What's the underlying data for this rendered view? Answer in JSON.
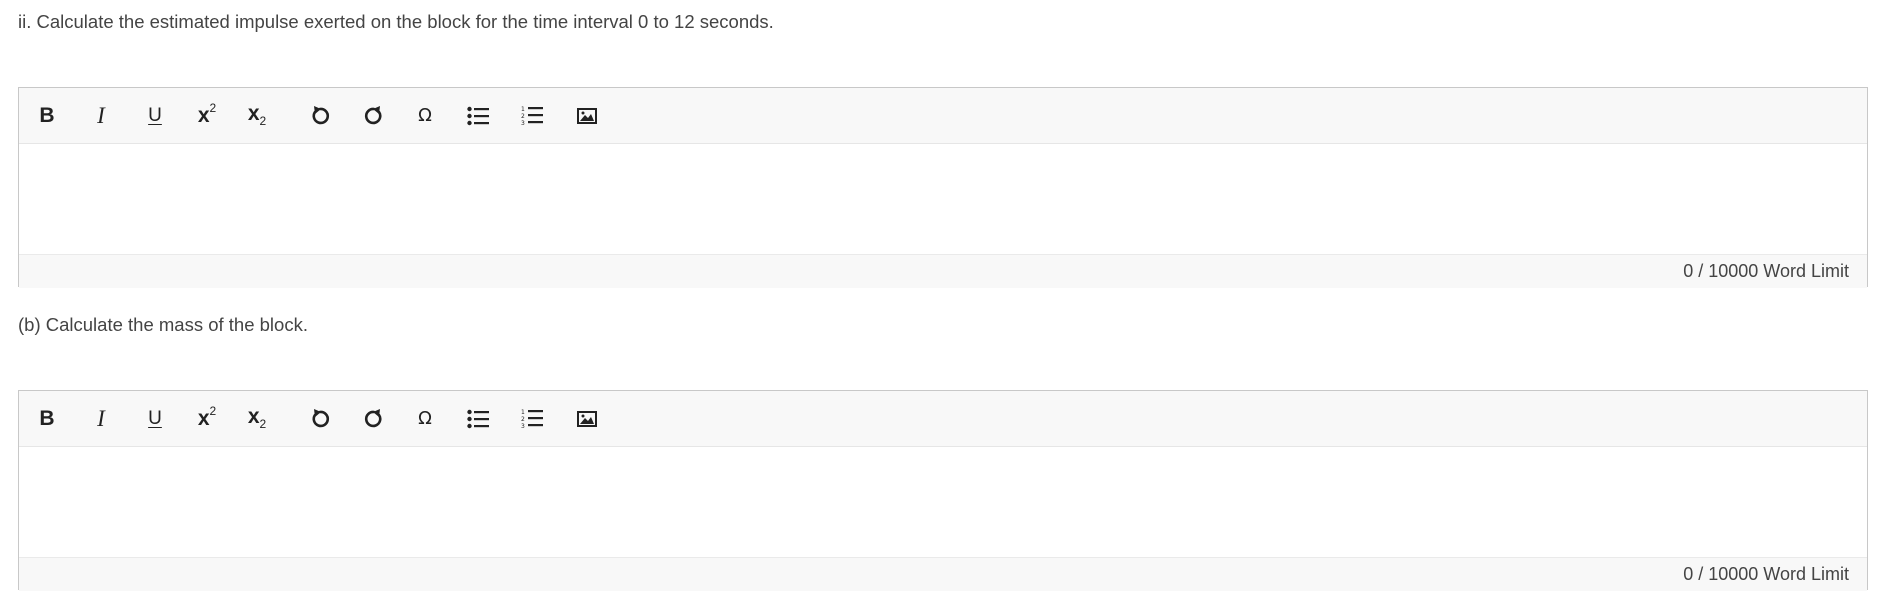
{
  "questions": [
    {
      "prompt": "ii. Calculate the estimated impulse exerted on the block for the time interval 0 to 12 seconds.",
      "editor": {
        "toolbar": {
          "bold": "B",
          "italic": "I",
          "underline": "U",
          "superscript": "x",
          "superscript_mark": "2",
          "subscript": "x",
          "subscript_mark": "2",
          "special_char": "Ω"
        },
        "content": "",
        "word_count": "0",
        "word_limit": "/ 10000 Word Limit"
      }
    },
    {
      "prompt": "(b) Calculate the mass of the block.",
      "editor": {
        "toolbar": {
          "bold": "B",
          "italic": "I",
          "underline": "U",
          "superscript": "x",
          "superscript_mark": "2",
          "subscript": "x",
          "subscript_mark": "2",
          "special_char": "Ω"
        },
        "content": "",
        "word_count": "0",
        "word_limit": "/ 10000 Word Limit"
      }
    }
  ],
  "icons": [
    "bold-icon",
    "italic-icon",
    "underline-icon",
    "superscript-icon",
    "subscript-icon",
    "undo-icon",
    "redo-icon",
    "special-character-icon",
    "bulleted-list-icon",
    "numbered-list-icon",
    "image-icon"
  ]
}
